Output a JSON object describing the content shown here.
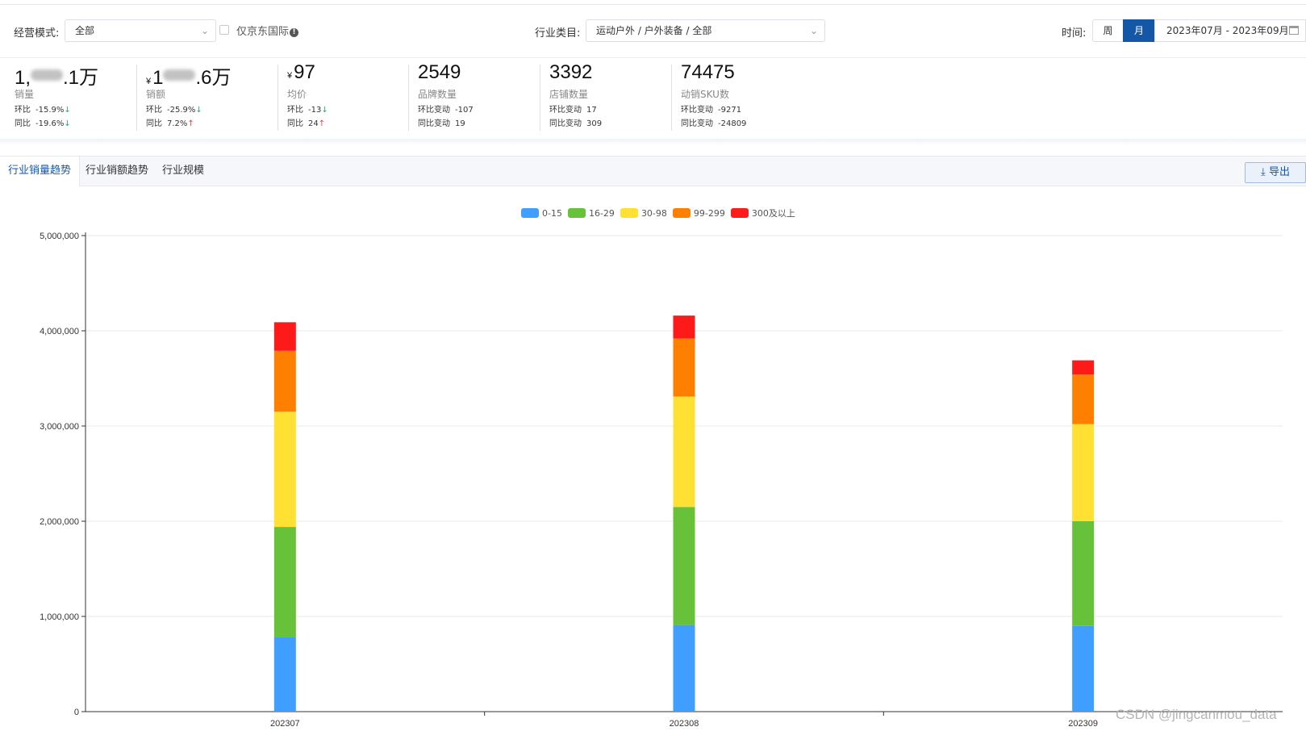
{
  "filters": {
    "mode_label": "经营模式:",
    "mode_value": "全部",
    "jd_intl_label": "仅京东国际",
    "category_label": "行业类目:",
    "category_value": "运动户外 / 户外装备 / 全部",
    "time_label": "时间:",
    "time_week": "周",
    "time_month": "月",
    "date_range": "2023年07月 - 2023年09月"
  },
  "metrics": [
    {
      "value_prefix": "1,",
      "value_suffix": ".1万",
      "value_blurred": true,
      "currency": "",
      "name": "销量",
      "r1_key": "环比",
      "r1_val": "-15.9%",
      "r1_dir": "down",
      "r2_key": "同比",
      "r2_val": "-19.6%",
      "r2_dir": "down"
    },
    {
      "value_prefix": "1",
      "value_suffix": ".6万",
      "value_blurred": true,
      "currency": "¥",
      "name": "销额",
      "r1_key": "环比",
      "r1_val": "-25.9%",
      "r1_dir": "down",
      "r2_key": "同比",
      "r2_val": "7.2%",
      "r2_dir": "up"
    },
    {
      "value_prefix": "97",
      "value_suffix": "",
      "value_blurred": false,
      "currency": "¥",
      "name": "均价",
      "r1_key": "环比",
      "r1_val": "-13",
      "r1_dir": "down",
      "r2_key": "同比",
      "r2_val": "24",
      "r2_dir": "up"
    },
    {
      "value_prefix": "2549",
      "value_suffix": "",
      "value_blurred": false,
      "currency": "",
      "name": "品牌数量",
      "r1_key": "环比变动",
      "r1_val": "-107",
      "r1_dir": "",
      "r2_key": "同比变动",
      "r2_val": "19",
      "r2_dir": ""
    },
    {
      "value_prefix": "3392",
      "value_suffix": "",
      "value_blurred": false,
      "currency": "",
      "name": "店铺数量",
      "r1_key": "环比变动",
      "r1_val": "17",
      "r1_dir": "",
      "r2_key": "同比变动",
      "r2_val": "309",
      "r2_dir": ""
    },
    {
      "value_prefix": "74475",
      "value_suffix": "",
      "value_blurred": false,
      "currency": "",
      "name": "动销SKU数",
      "r1_key": "环比变动",
      "r1_val": "-9271",
      "r1_dir": "",
      "r2_key": "同比变动",
      "r2_val": "-24809",
      "r2_dir": ""
    }
  ],
  "tabs": [
    {
      "label": "行业销量趋势",
      "active": true
    },
    {
      "label": "行业销额趋势",
      "active": false
    },
    {
      "label": "行业规模",
      "active": false
    }
  ],
  "export_label": "导出",
  "icons": {
    "export": "download-icon",
    "calendar": "calendar-icon",
    "info": "info-icon",
    "dropdown": "chevron-down-icon"
  },
  "colors": {
    "accent": "#1557a7",
    "down": "#27b16a",
    "up": "#e8413c"
  },
  "chart_data": {
    "type": "bar",
    "stacked": true,
    "categories": [
      "202307",
      "202308",
      "202309"
    ],
    "series": [
      {
        "name": "0-15",
        "color": "#409eff",
        "values": [
          780000,
          910000,
          900000
        ]
      },
      {
        "name": "16-29",
        "color": "#67c23a",
        "values": [
          1160000,
          1240000,
          1100000
        ]
      },
      {
        "name": "30-98",
        "color": "#ffe033",
        "values": [
          1210000,
          1160000,
          1020000
        ]
      },
      {
        "name": "99-299",
        "color": "#ff8000",
        "values": [
          640000,
          610000,
          520000
        ]
      },
      {
        "name": "300及以上",
        "color": "#ff1a1a",
        "values": [
          300000,
          240000,
          150000
        ]
      }
    ],
    "yticks": [
      "0",
      "1,000,000",
      "2,000,000",
      "3,000,000",
      "4,000,000",
      "5,000,000"
    ],
    "ylim": [
      0,
      5000000
    ],
    "legend": "top-center",
    "grid": true
  },
  "watermark": "CSDN @jingcanmou_data"
}
